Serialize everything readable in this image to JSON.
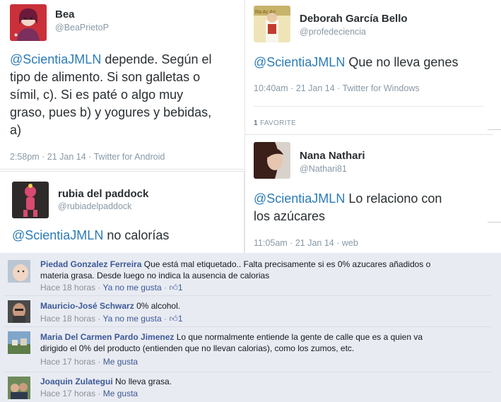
{
  "tweets": [
    {
      "name": "Bea",
      "handle": "@BeaPrietoP",
      "mention": "@ScientiaJMLN",
      "text_lines": [
        "depende. Según el",
        "tipo de alimento. Si son galletas o",
        "símil, c). Si es paté o algo muy",
        "graso, pues b) y yogures y bebidas,",
        "a)"
      ],
      "meta": "2:58pm · 21 Jan 14 · Twitter for Android"
    },
    {
      "name": "Deborah García Bello",
      "handle": "@profedeciencia",
      "mention": "@ScientiaJMLN",
      "text_lines": [
        "Que no lleva genes"
      ],
      "meta": "10:40am · 21 Jan 14 · Twitter for Windows",
      "favorites_count": "1",
      "favorites_label": "FAVORITE"
    },
    {
      "name": "rubia del paddock",
      "handle": "@rubiadelpaddock",
      "mention": "@ScientiaJMLN",
      "text_lines": [
        "no calorías"
      ]
    },
    {
      "name": "Nana Nathari",
      "handle": "@Nathari81",
      "mention": "@ScientiaJMLN",
      "text_lines": [
        "Lo relaciono con",
        "los azúcares"
      ],
      "meta": "11:05am · 21 Jan 14 · web"
    }
  ],
  "comments": [
    {
      "name": "Piedad Gonzalez Ferreira",
      "text_first": "Que está mal etiquetado.. Falta precisamente si es 0% azucares añadidos o",
      "text_second": "materia grasa. Desde luego no indica la ausencia de calorias",
      "time": "Hace 18 horas",
      "sep": " · ",
      "like_label": "Ya no me gusta",
      "like_count": "1"
    },
    {
      "name": "Mauricio-José Schwarz",
      "text_first": "0% alcohol.",
      "time": "Hace 18 horas",
      "sep": " · ",
      "like_label": "Ya no me gusta",
      "like_count": "1"
    },
    {
      "name": "Maria Del Carmen Pardo Jimenez",
      "text_first": "Lo que normalmente entiende la gente de calle que es a quien va",
      "text_second": "dirigido el 0% del producto (entienden que no llevan calorias), como los zumos, etc.",
      "time": "Hace 17 horas",
      "sep": " · ",
      "like_label": "Me gusta"
    },
    {
      "name": "Joaquin Zulategui",
      "text_first": "No lleva grasa.",
      "time": "Hace 17 horas",
      "sep": " · ",
      "like_label": "Me gusta"
    }
  ],
  "icons": {
    "thumb": "thumbs-up-icon"
  },
  "colors": {
    "twitter_link": "#2b7bb9",
    "facebook_link": "#3b5998",
    "facebook_bg": "#e9ebf2"
  }
}
